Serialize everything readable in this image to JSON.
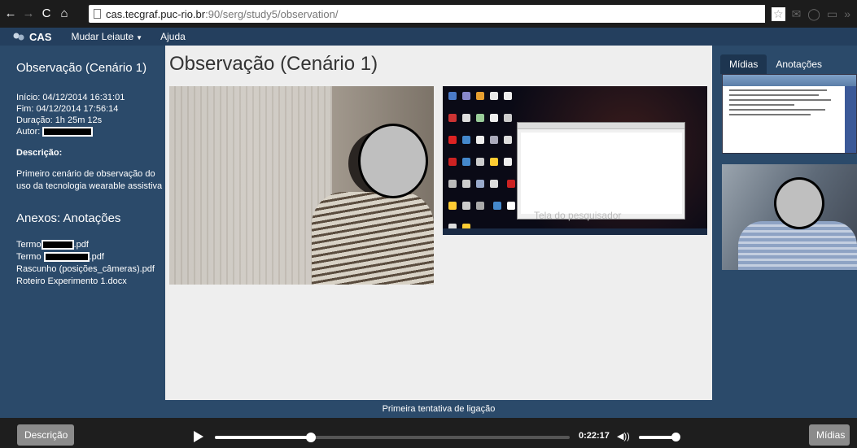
{
  "browser": {
    "url_host": "cas.tecgraf.puc-rio.br",
    "url_path": ":90/serg/study5/observation/"
  },
  "appbar": {
    "brand": "CAS",
    "menu_layout": "Mudar Leiaute",
    "menu_help": "Ajuda"
  },
  "sidebar": {
    "title": "Observação (Cenário 1)",
    "start": "Início: 04/12/2014 16:31:01",
    "end": "Fim: 04/12/2014 17:56:14",
    "duration": "Duração: 1h 25m 12s",
    "author_label": "Autor:",
    "description_label": "Descrição:",
    "description_text": "Primeiro cenário de observação do uso da tecnologia wearable assistiva",
    "attachments_title": "Anexos: Anotações",
    "files": [
      {
        "prefix": "Termo",
        "suffix": ".pdf"
      },
      {
        "prefix": "Termo",
        "suffix": ".pdf"
      },
      {
        "name": "Rascunho (posições_câmeras).pdf"
      },
      {
        "name": "Roteiro Experimento 1.docx"
      }
    ]
  },
  "main": {
    "title": "Observação (Cenário 1)",
    "screen_overlay_text": "Tela do pesquisador",
    "caption": "Primeira tentativa de ligação"
  },
  "right_panel": {
    "tabs": [
      {
        "label": "Mídias",
        "active": true
      },
      {
        "label": "Anotações",
        "active": false
      }
    ]
  },
  "player": {
    "description_button": "Descrição",
    "media_button": "Mídias",
    "time": "0:22:17",
    "progress_fraction": 0.27,
    "volume_fraction": 0.9
  }
}
